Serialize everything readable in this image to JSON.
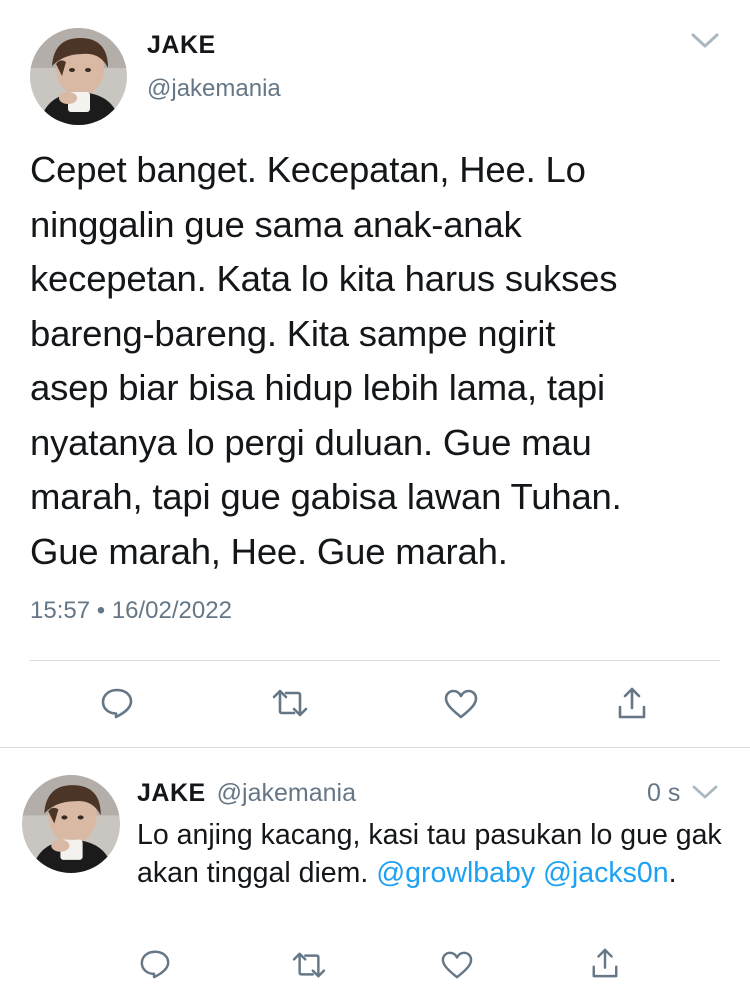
{
  "main_tweet": {
    "name": "JAKE",
    "handle": "@jakemania",
    "text": "Cepet banget. Kecepatan, Hee. Lo\nninggalin gue sama anak-anak\nkecepetan. Kata lo kita harus sukses\nbareng-bareng. Kita sampe ngirit\nasep biar bisa hidup lebih lama, tapi\nnyatanya lo pergi duluan. Gue mau\nmarah, tapi gue gabisa lawan Tuhan.\nGue marah, Hee. Gue marah.",
    "timestamp": "15:57 • 16/02/2022"
  },
  "reply_tweet": {
    "name": "JAKE",
    "handle": "@jakemania",
    "time": "0 s",
    "text": "Lo anjing kacang, kasi tau pasukan lo gue gak akan tinggal diem. ",
    "mention_1": "@growlbaby",
    "mention_2": "@jacks0n",
    "text_end": "."
  },
  "icons": {
    "menu": "chevron-down-icon",
    "reply": "reply-bubble-icon",
    "retweet": "retweet-icon",
    "like": "heart-icon",
    "share": "share-icon"
  },
  "colors": {
    "text": "#14171a",
    "secondary": "#657786",
    "link": "#1da1f2",
    "divider": "#d6dbdf"
  }
}
